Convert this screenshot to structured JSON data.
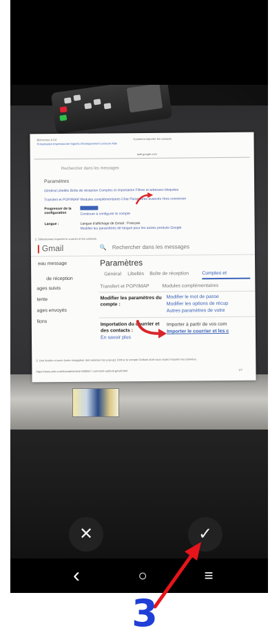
{
  "paper": {
    "browser_top_left": "Bienvenue à Cd",
    "browser_tabs": "Présentation  Impressionné  Signets  Développement  Lecteurs  Aide",
    "browser_center": "Comment importer les contacts",
    "url_bar": "mail.google.com",
    "search_small": "Rechercher dans les messages",
    "settings_small": "Paramètres",
    "tabs_small": "Général   Libellés   Boîte de réception   Comptes et importation   Filtres et adresses bloquées",
    "tabs_small_2": "Transfert et POP/IMAP   Modules complémentaires   Chat   Paramètres avancés   Hors connexion",
    "row1_label": "Progresser de la configuration",
    "row1_value": "Continuer à configurer le compte",
    "row2_label": "Langue :",
    "row2_value": "Langue d'affichage de Gmail : Français",
    "row2_value2": "Modifier les paramètres de langue pour les autres produits Google",
    "step_note": "2. Sélectionnez Importer le courrier et les contacts.",
    "gmail_logo": "Gmail",
    "search": "Rechercher dans les messages",
    "sidebar": [
      "eau message",
      "de réception",
      "ages suivis",
      "tente",
      "ages envoyés",
      "llons"
    ],
    "settings_title": "Paramètres",
    "tabs": [
      "Général",
      "Libellés",
      "Boîte de réception",
      "Comptes et"
    ],
    "tabs_2": [
      "Transfert et POP/IMAP",
      "Modules complémentaires"
    ],
    "modify_label": "Modifier les paramètres du compte :",
    "modify_links": [
      "Modifier le mot de passe",
      "Modifier les options de récup",
      "Autres paramètres de votre"
    ],
    "import_label": "Importation du courrier et des contacts :",
    "import_text": "Importer à partir de vos com",
    "import_link": "Importer le courrier et les c",
    "learn_more": "En savoir plus",
    "footer_note": "3. Une fenêtre s'ouvre (votre navigateur doit autoriser les pop-up). Entrez le compte Outlook dont vous voulez importer les données.",
    "footer_url": "https://www.zebi.com/tutorials/article-968250 / comment-outlook-gmail.html",
    "page_num": "1/7"
  },
  "controls": {
    "discard": "✕",
    "confirm": "✓"
  },
  "navbar": {
    "back": "‹",
    "home": "○",
    "recents": "≡"
  },
  "annotation": {
    "step_number": "3",
    "arrow_color": "#e8141b",
    "label_color": "#1f3fd6"
  }
}
